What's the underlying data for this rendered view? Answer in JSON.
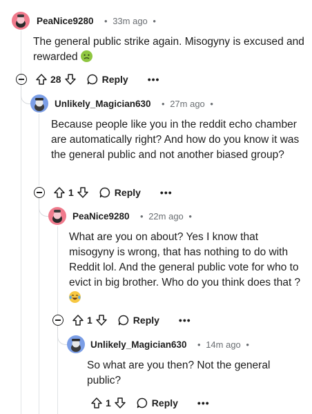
{
  "comments": [
    {
      "username": "PeaNice9280",
      "time": "33m ago",
      "body": "The general public strike again. Misogyny is excused and rewarded",
      "emoji": "nauseated-face",
      "votes": "28",
      "reply_label": "Reply",
      "more_label": "•••"
    },
    {
      "username": "Unlikely_Magician630",
      "time": "27m ago",
      "body": "Because people like you in the reddit echo chamber are automatically right? And how do you know it was the general public and not another biased group?",
      "votes": "1",
      "reply_label": "Reply",
      "more_label": "•••"
    },
    {
      "username": "PeaNice9280",
      "time": "22m ago",
      "body": "What are you on about? Yes I know that misogyny is wrong, that has nothing to do with Reddit lol. And the general public vote for who to evict in big brother. Who do you think does that ?",
      "emoji": "tears-of-joy",
      "votes": "1",
      "reply_label": "Reply",
      "more_label": "•••"
    },
    {
      "username": "Unlikely_Magician630",
      "time": "14m ago",
      "body": "So what are you then? Not the general public?",
      "votes": "1",
      "reply_label": "Reply",
      "more_label": "•••"
    }
  ],
  "separator": "•",
  "colors": {
    "avatar_pink": "#f07a8c",
    "avatar_blue": "#7b9ee6",
    "thread_line": "#e0e3e6",
    "meta_gray": "#6a6e72"
  }
}
